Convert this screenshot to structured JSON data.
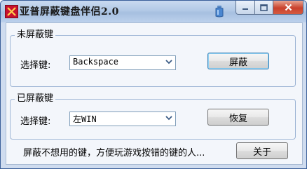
{
  "window": {
    "title": "亚普屏蔽键盘伴侣2.0",
    "icons": [
      "app-icon",
      "tray-icon",
      "minimize-icon",
      "maximize-icon",
      "close-icon"
    ]
  },
  "unblocked": {
    "group_title": "未屏蔽键",
    "select_label": "选择键:",
    "selected_key": "Backspace",
    "action_button": "屏蔽"
  },
  "blocked": {
    "group_title": "已屏蔽键",
    "select_label": "选择键:",
    "selected_key": "左WIN",
    "action_button": "恢复"
  },
  "footer": {
    "description": "屏蔽不想用的键，方便玩游戏按错的键的人...",
    "about_button": "关于"
  },
  "colors": {
    "titlebar": "#b2c9e6",
    "close_button": "#c9412c",
    "client_background": "#f3f6fb",
    "group_border": "#9fb6d6"
  }
}
